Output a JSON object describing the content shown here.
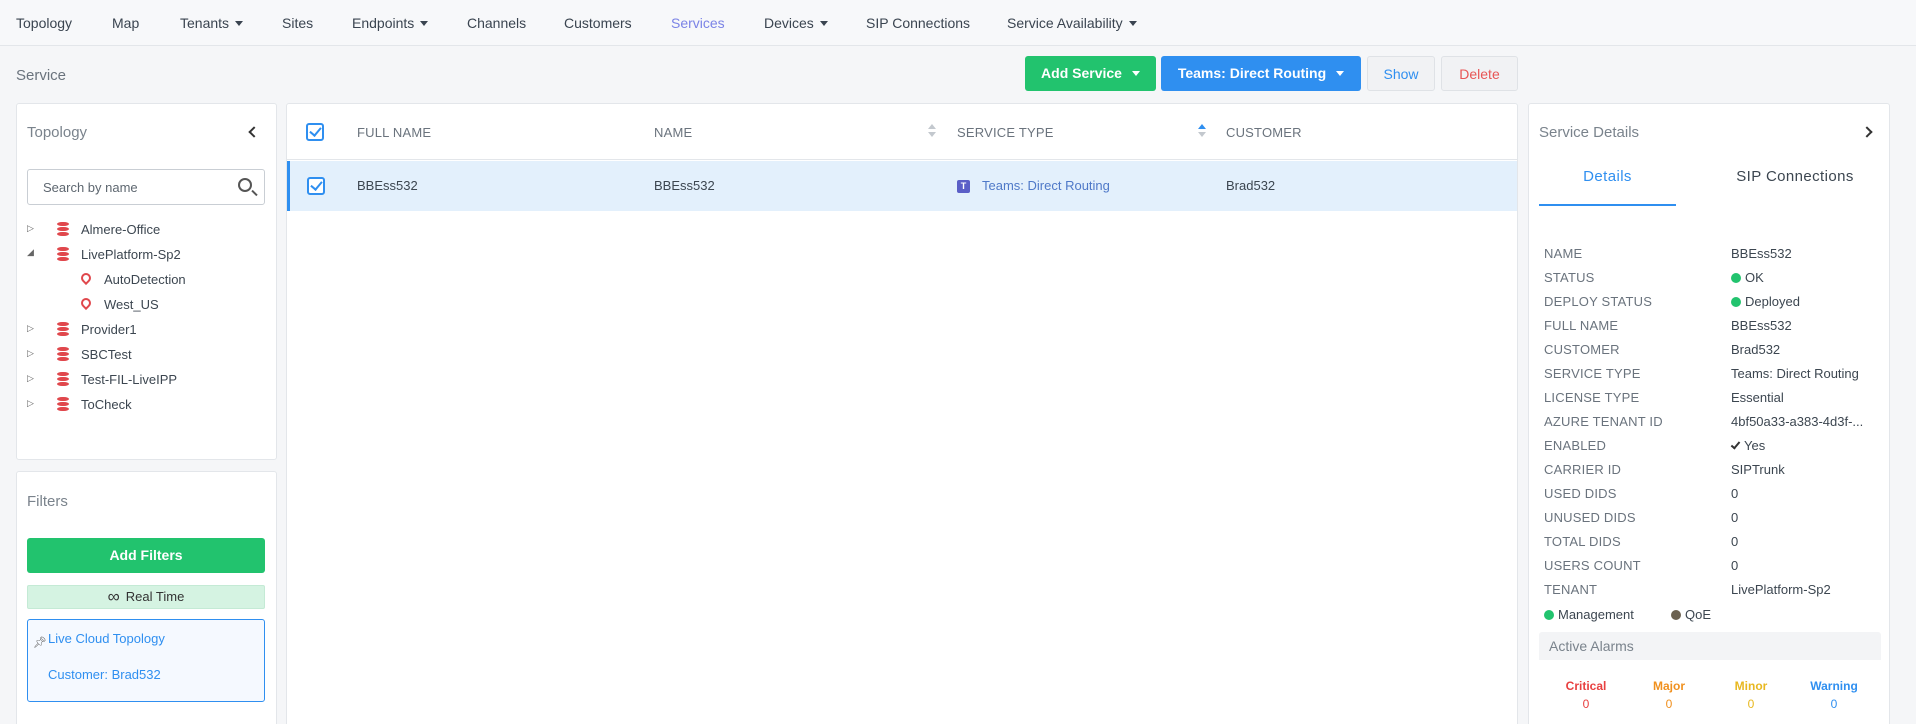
{
  "nav": {
    "items": [
      {
        "label": "Topology",
        "caret": false
      },
      {
        "label": "Map",
        "caret": false
      },
      {
        "label": "Tenants",
        "caret": true
      },
      {
        "label": "Sites",
        "caret": false
      },
      {
        "label": "Endpoints",
        "caret": true
      },
      {
        "label": "Channels",
        "caret": false
      },
      {
        "label": "Customers",
        "caret": false
      },
      {
        "label": "Services",
        "caret": false,
        "active": true
      },
      {
        "label": "Devices",
        "caret": true
      },
      {
        "label": "SIP Connections",
        "caret": false
      },
      {
        "label": "Service Availability",
        "caret": true
      }
    ]
  },
  "page": {
    "title": "Service",
    "add_service_label": "Add Service",
    "teams_label": "Teams: Direct Routing",
    "show_label": "Show",
    "delete_label": "Delete"
  },
  "topology": {
    "title": "Topology",
    "search_placeholder": "Search by name",
    "tree": [
      {
        "label": "Almere-Office",
        "toggle": "▷",
        "icon": "database-icon",
        "level": 0
      },
      {
        "label": "LivePlatform-Sp2",
        "toggle": "◢",
        "icon": "database-icon",
        "level": 0
      },
      {
        "label": "AutoDetection",
        "toggle": "",
        "icon": "location-pin-icon",
        "level": 1
      },
      {
        "label": "West_US",
        "toggle": "",
        "icon": "location-pin-icon",
        "level": 1
      },
      {
        "label": "Provider1",
        "toggle": "▷",
        "icon": "database-icon",
        "level": 0
      },
      {
        "label": "SBCTest",
        "toggle": "▷",
        "icon": "database-icon",
        "level": 0
      },
      {
        "label": "Test-FIL-LiveIPP",
        "toggle": "▷",
        "icon": "database-icon",
        "level": 0
      },
      {
        "label": "ToCheck",
        "toggle": "▷",
        "icon": "database-icon",
        "level": 0
      }
    ]
  },
  "filters": {
    "title": "Filters",
    "add_label": "Add Filters",
    "realtime_label": "Real Time",
    "realtime_icon": "∞",
    "active": [
      "Live Cloud Topology",
      "Customer: Brad532"
    ]
  },
  "table": {
    "columns": [
      "FULL NAME",
      "NAME",
      "SERVICE TYPE",
      "CUSTOMER"
    ],
    "rows": [
      {
        "full_name": "BBEss532",
        "name": "BBEss532",
        "service_type": "Teams: Direct Routing",
        "customer": "Brad532"
      }
    ]
  },
  "details": {
    "title": "Service Details",
    "tabs": [
      "Details",
      "SIP Connections"
    ],
    "fields": [
      {
        "label": "NAME",
        "value": "BBEss532"
      },
      {
        "label": "STATUS",
        "value": "OK",
        "dot": "#22c36e"
      },
      {
        "label": "DEPLOY STATUS",
        "value": "Deployed",
        "dot": "#22c36e"
      },
      {
        "label": "FULL NAME",
        "value": "BBEss532"
      },
      {
        "label": "CUSTOMER",
        "value": "Brad532"
      },
      {
        "label": "SERVICE TYPE",
        "value": "Teams: Direct Routing"
      },
      {
        "label": "LICENSE TYPE",
        "value": "Essential"
      },
      {
        "label": "AZURE TENANT ID",
        "value": "4bf50a33-a383-4d3f-..."
      },
      {
        "label": "ENABLED",
        "value": "Yes",
        "check": true
      },
      {
        "label": "CARRIER ID",
        "value": "SIPTrunk"
      },
      {
        "label": "USED DIDS",
        "value": "0"
      },
      {
        "label": "UNUSED DIDS",
        "value": "0"
      },
      {
        "label": "TOTAL DIDS",
        "value": "0"
      },
      {
        "label": "USERS COUNT",
        "value": "0"
      },
      {
        "label": "TENANT",
        "value": "LivePlatform-Sp2"
      }
    ],
    "legend": [
      {
        "label": "Management",
        "color": "#22c36e"
      },
      {
        "label": "QoE",
        "color": "#6b6150"
      }
    ],
    "alarms": {
      "title": "Active Alarms",
      "items": [
        {
          "label": "Critical",
          "value": "0",
          "color": "#e84040"
        },
        {
          "label": "Major",
          "value": "0",
          "color": "#f0901e"
        },
        {
          "label": "Minor",
          "value": "0",
          "color": "#e8b820"
        },
        {
          "label": "Warning",
          "value": "0",
          "color": "#2f8ff0"
        }
      ]
    }
  },
  "colors": {
    "accent": "#2f8ff0",
    "success": "#22c36e",
    "danger": "#e85555",
    "nav_active": "#7b83e6",
    "tree_icon": "#e0474c"
  }
}
